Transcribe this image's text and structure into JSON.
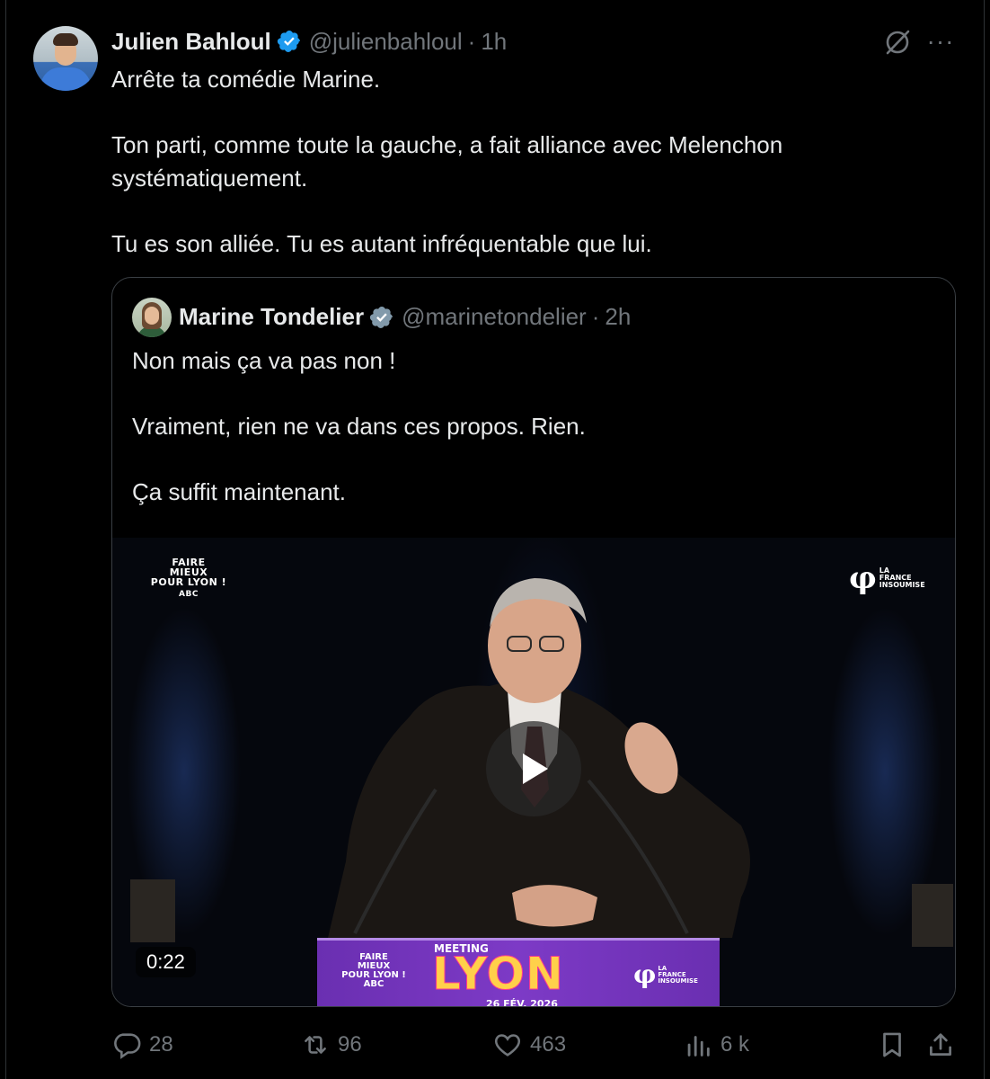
{
  "tweet": {
    "author_name": "Julien Bahloul",
    "handle": "@julienbahloul",
    "separator": "·",
    "time": "1h",
    "more_label": "···",
    "lines": {
      "l1": "Arrête ta comédie Marine.",
      "l2": "Ton parti, comme toute la gauche, a fait alliance avec Melenchon",
      "l3": "systématiquement.",
      "l4": "Tu es son alliée. Tu es autant infréquentable que lui."
    }
  },
  "quoted": {
    "author_name": "Marine Tondelier",
    "handle": "@marinetondelier",
    "separator": "·",
    "time": "2h",
    "lines": {
      "l1": "Non mais ça va pas non !",
      "l2": "Vraiment, rien ne va dans ces propos. Rien.",
      "l3": "Ça suffit maintenant."
    },
    "video": {
      "duration": "0:22",
      "overlay_left": [
        "FAIRE",
        "MIEUX",
        "POUR LYON !",
        "ABC"
      ],
      "overlay_right_symbol": "φ",
      "overlay_right_text": [
        "LA",
        "FRANCE",
        "INSOUMISE"
      ],
      "lectern_left": [
        "FAIRE",
        "MIEUX",
        "POUR LYON !",
        "ABC"
      ],
      "lectern_meeting": "MEETING",
      "lectern_city": "LYON",
      "lectern_date": "26 FÉV. 2026"
    }
  },
  "actions": {
    "replies": "28",
    "reposts": "96",
    "likes": "463",
    "views": "6 k"
  },
  "colors": {
    "background": "#000000",
    "text": "#e7e9ea",
    "muted": "#71767b",
    "verified": "#1d9bf0",
    "border": "#2f3336"
  },
  "icons": {
    "verified": "verified-badge-icon",
    "grok": "grok-icon",
    "more": "more-icon",
    "reply": "reply-icon",
    "repost": "repost-icon",
    "like": "heart-icon",
    "views": "views-icon",
    "bookmark": "bookmark-icon",
    "share": "share-icon",
    "play": "play-icon"
  }
}
